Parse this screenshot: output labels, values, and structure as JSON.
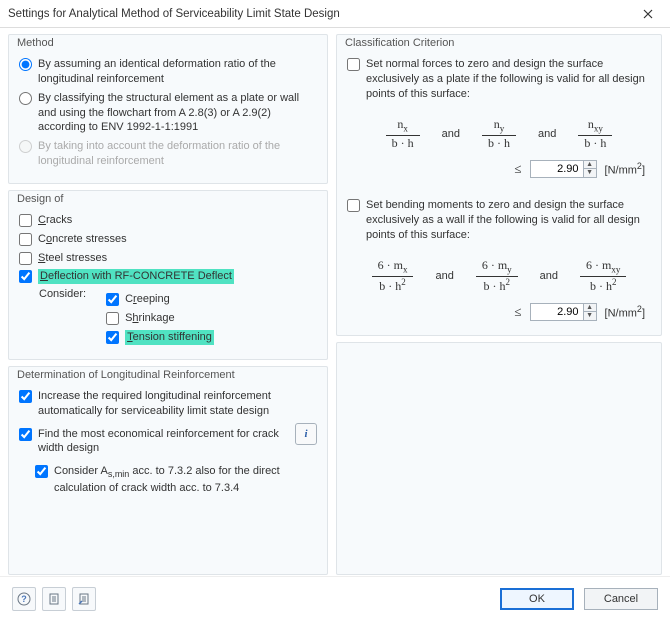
{
  "window": {
    "title": "Settings for Analytical Method of Serviceability Limit State Design"
  },
  "method": {
    "title": "Method",
    "opt1": "By assuming an identical deformation ratio of the longitudinal reinforcement",
    "opt2": "By classifying the structural element as a plate or wall and using the flowchart from A 2.8(3) or A 2.9(2) according to ENV 1992-1-1:1991",
    "opt3": "By taking into account the deformation ratio of the longitudinal reinforcement"
  },
  "design_of": {
    "title": "Design of",
    "cracks": "Cracks",
    "concrete": "Concrete stresses",
    "steel": "Steel stresses",
    "deflect": "Deflection with RF-CONCRETE Deflect",
    "consider": "Consider:",
    "creeping": "Creeping",
    "shrinkage": "Shrinkage",
    "tension": "Tension stiffening"
  },
  "determination": {
    "title": "Determination of Longitudinal Reinforcement",
    "increase": "Increase the required longitudinal reinforcement automatically for serviceability limit state design",
    "economical": "Find the most economical reinforcement for crack width design",
    "asmin_prefix": "Consider A",
    "asmin_sub": "s,min",
    "asmin_rest": " acc. to 7.3.2 also for the direct calculation of crack width acc. to 7.3.4"
  },
  "classification": {
    "title": "Classification Criterion",
    "plate_text": "Set normal forces to zero and design the surface exclusively as a plate if the following is valid for all design points of this surface:",
    "wall_text": "Set bending moments to zero and design the surface exclusively as a wall if the following is valid for all design points of this surface:",
    "and": "and",
    "limit1": "2.90",
    "limit2": "2.90",
    "unit": "[N/mm²]"
  },
  "footer": {
    "ok": "OK",
    "cancel": "Cancel"
  }
}
